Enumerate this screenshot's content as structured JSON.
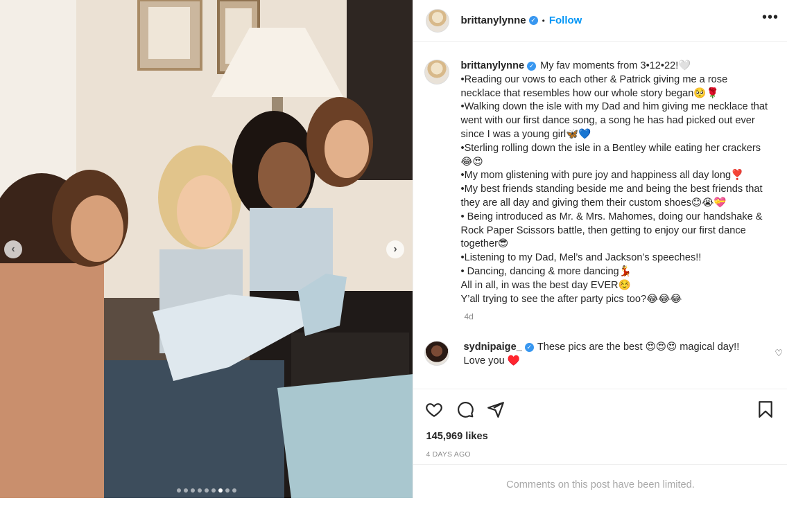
{
  "media": {
    "carousel_dot_count": 9,
    "carousel_active_index": 6
  },
  "header": {
    "username": "brittanylynne",
    "separator": "•",
    "follow_label": "Follow",
    "more_label": "•••"
  },
  "caption": {
    "username": "brittanylynne",
    "text": "My fav moments from 3•12•22!🤍\n•Reading our vows to each other & Patrick giving me a rose necklace that resembles how our whole story began🥺🌹\n•Walking down the isle with my Dad and him giving me necklace that went with our first dance song, a song he has had picked out ever since I was a young girl🦋💙\n•Sterling rolling down the isle in a Bentley while eating her crackers😂😍\n•My mom glistening with pure joy and happiness all day long❣️\n•My best friends standing beside me and being the best friends that they are all day and giving them their custom shoes😊😭💝\n• Being introduced as Mr. & Mrs. Mahomes, doing our handshake & Rock Paper Scissors battle, then getting to enjoy our first dance together😎\n•Listening to my Dad, Mel’s and Jackson’s speeches!!\n• Dancing, dancing & more dancing💃\nAll in all, in was the best day EVER☺️\nY’all trying to see the after party pics too?😂😂😂",
    "age": "4d"
  },
  "comment": {
    "username": "sydnipaige_",
    "text": "These pics are the best 😍😍😍 magical day!! Love you ♥️"
  },
  "stats": {
    "likes": "145,969 likes",
    "date": "4 DAYS AGO"
  },
  "footer": {
    "limited": "Comments on this post have been limited."
  },
  "icons": {
    "like": "heart-icon",
    "comment": "comment-icon",
    "share": "send-icon",
    "save": "bookmark-icon"
  },
  "colors": {
    "link": "#0095f6",
    "verified": "#3897f0",
    "muted": "#8e8e8e"
  }
}
